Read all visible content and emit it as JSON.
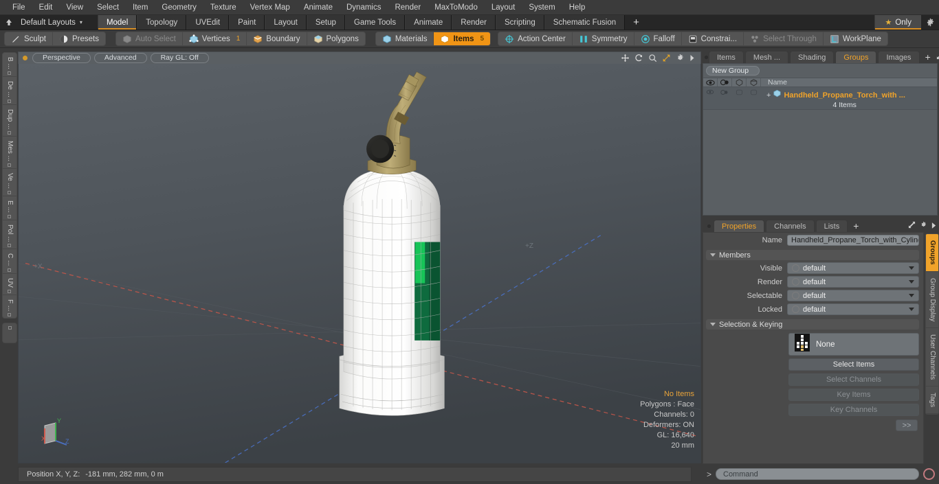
{
  "menu": {
    "items": [
      "File",
      "Edit",
      "View",
      "Select",
      "Item",
      "Geometry",
      "Texture",
      "Vertex Map",
      "Animate",
      "Dynamics",
      "Render",
      "MaxToModo",
      "Layout",
      "System",
      "Help"
    ]
  },
  "layout_bar": {
    "layout_name": "Default Layouts",
    "caret": "▾",
    "tabs": [
      "Model",
      "Topology",
      "UVEdit",
      "Paint",
      "Layout",
      "Setup",
      "Game Tools",
      "Animate",
      "Render",
      "Scripting",
      "Schematic Fusion"
    ],
    "active_tab": "Model",
    "add_tab": "+",
    "only_label": "Only",
    "star_glyph": "★"
  },
  "mode_toolbar": {
    "left_group": [
      {
        "label": "Sculpt",
        "icon": "pen-icon",
        "state": "normal"
      },
      {
        "label": "Presets",
        "icon": "sphere-icon",
        "state": "normal"
      }
    ],
    "select_group": [
      {
        "label": "Auto Select",
        "icon": "cube-gray-icon",
        "state": "disabled",
        "count": ""
      },
      {
        "label": "Vertices",
        "icon": "cube-blue-icon",
        "state": "normal",
        "count": "1"
      },
      {
        "label": "Boundary",
        "icon": "cube-orange-icon",
        "state": "normal",
        "count": ""
      },
      {
        "label": "Polygons",
        "icon": "cube-tan-icon",
        "state": "normal",
        "count": ""
      }
    ],
    "item_group": [
      {
        "label": "Materials",
        "icon": "cube-blue-icon",
        "state": "normal",
        "count": ""
      },
      {
        "label": "Items",
        "icon": "cube-orange-icon",
        "state": "selected",
        "count": "5"
      }
    ],
    "right_group": [
      {
        "label": "Action Center",
        "icon": "target-icon",
        "state": "normal"
      },
      {
        "label": "Symmetry",
        "icon": "symmetry-icon",
        "state": "normal"
      },
      {
        "label": "Falloff",
        "icon": "falloff-icon",
        "state": "normal"
      },
      {
        "label": "Constrai...",
        "icon": "constraint-icon",
        "state": "normal"
      },
      {
        "label": "Select Through",
        "icon": "select-through-icon",
        "state": "disabled"
      },
      {
        "label": "WorkPlane",
        "icon": "workplane-icon",
        "state": "normal"
      }
    ]
  },
  "left_strip": {
    "tabs": [
      "B ...",
      "De ...",
      "Dup ...",
      "Mes ...",
      "Ve ...",
      "E ...",
      "Pol ...",
      "C ...",
      "UV",
      "F ..."
    ]
  },
  "viewport": {
    "header": {
      "view_mode": "Perspective",
      "shading": "Advanced",
      "raygl": "Ray GL: Off",
      "icons": [
        "move-icon",
        "rotate-icon",
        "zoom-icon",
        "fit-icon",
        "gear-icon",
        "chevron-right-icon"
      ]
    },
    "axis_labels": {
      "x": "+X",
      "z": "+Z"
    },
    "gizmo": {
      "x": "X",
      "y": "Y",
      "z": "Z"
    },
    "stats": {
      "selection": "No Items",
      "polygons": "Polygons : Face",
      "channels": "Channels: 0",
      "deformers": "Deformers: ON",
      "gl": "GL: 16,640",
      "scale": "20 mm"
    }
  },
  "right_panel": {
    "top_tabs": [
      "Items",
      "Mesh ...",
      "Shading",
      "Groups",
      "Images"
    ],
    "top_active": "Groups",
    "add_tab": "+",
    "new_group_button": "New Group",
    "list_header": {
      "columns": [
        "eye-icon",
        "render-icon",
        "select-icon",
        "lock-icon"
      ],
      "name": "Name"
    },
    "rows": [
      {
        "name": "Handheld_Propane_Torch_with ...",
        "sub": "4 Items",
        "expander": "+",
        "icon": "group-icon"
      }
    ],
    "prop_tabs": [
      "Properties",
      "Channels",
      "Lists"
    ],
    "prop_active": "Properties",
    "prop_add": "+",
    "properties": {
      "name_label": "Name",
      "name_value": "Handheld_Propane_Torch_with_Cylind",
      "members_section": "Members",
      "members": [
        {
          "label": "Visible",
          "value": "default"
        },
        {
          "label": "Render",
          "value": "default"
        },
        {
          "label": "Selectable",
          "value": "default"
        },
        {
          "label": "Locked",
          "value": "default"
        }
      ],
      "selection_section": "Selection & Keying",
      "selection_value": "None",
      "buttons": [
        {
          "label": "Select Items",
          "state": "normal"
        },
        {
          "label": "Select Channels",
          "state": "disabled"
        },
        {
          "label": "Key Items",
          "state": "disabled"
        },
        {
          "label": "Key Channels",
          "state": "disabled"
        }
      ],
      "expand_button": ">>"
    },
    "side_tabs": [
      "Groups",
      "Group Display",
      "User Channels",
      "Tags"
    ],
    "side_active": "Groups"
  },
  "status_bar": {
    "position_label": "Position X, Y, Z:",
    "position_value": "-181 mm, 282 mm, 0 m",
    "command_arrow": ">",
    "command_placeholder": "Command",
    "record_button": "record-icon"
  },
  "colors": {
    "accent": "#f0a32a",
    "selected_tab_underline": "#d98f24",
    "viewport_bg": "#4e545a",
    "axis_x": "#c0564a",
    "axis_z": "#4a6fc0",
    "panel_bg": "#5a5f63"
  }
}
